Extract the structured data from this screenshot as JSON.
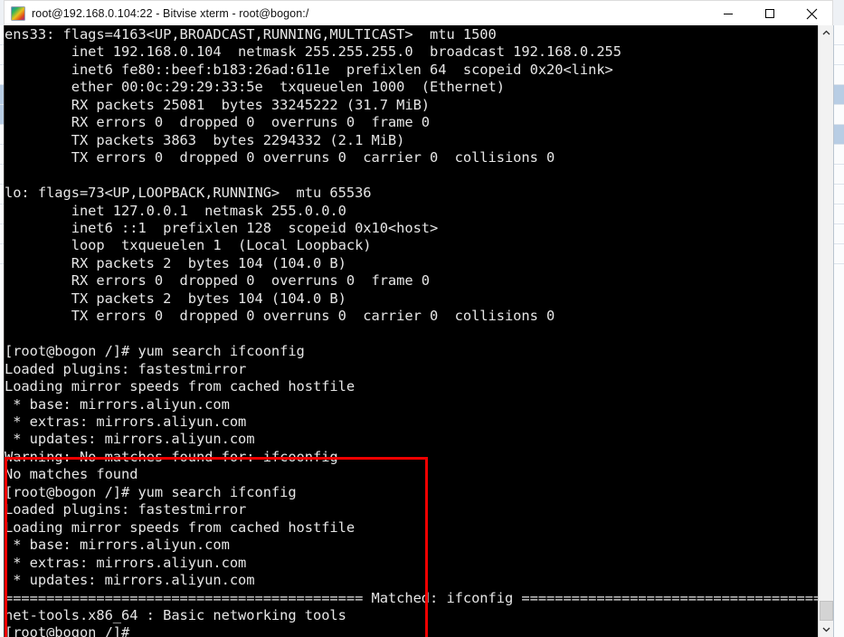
{
  "window": {
    "title": "root@192.168.0.104:22 - Bitvise xterm - root@bogon:/",
    "icon": "bitvise-logo-icon",
    "controls": {
      "minimize": "minimize-icon",
      "maximize": "maximize-icon",
      "close": "close-icon"
    }
  },
  "terminal": {
    "prompt": "[root@bogon /]#",
    "lines": [
      "ens33: flags=4163<UP,BROADCAST,RUNNING,MULTICAST>  mtu 1500",
      "        inet 192.168.0.104  netmask 255.255.255.0  broadcast 192.168.0.255",
      "        inet6 fe80::beef:b183:26ad:611e  prefixlen 64  scopeid 0x20<link>",
      "        ether 00:0c:29:29:33:5e  txqueuelen 1000  (Ethernet)",
      "        RX packets 25081  bytes 33245222 (31.7 MiB)",
      "        RX errors 0  dropped 0  overruns 0  frame 0",
      "        TX packets 3863  bytes 2294332 (2.1 MiB)",
      "        TX errors 0  dropped 0 overruns 0  carrier 0  collisions 0",
      "",
      "lo: flags=73<UP,LOOPBACK,RUNNING>  mtu 65536",
      "        inet 127.0.0.1  netmask 255.0.0.0",
      "        inet6 ::1  prefixlen 128  scopeid 0x10<host>",
      "        loop  txqueuelen 1  (Local Loopback)",
      "        RX packets 2  bytes 104 (104.0 B)",
      "        RX errors 0  dropped 0  overruns 0  frame 0",
      "        TX packets 2  bytes 104 (104.0 B)",
      "        TX errors 0  dropped 0 overruns 0  carrier 0  collisions 0",
      "",
      "[root@bogon /]# yum search ifcoonfig",
      "Loaded plugins: fastestmirror",
      "Loading mirror speeds from cached hostfile",
      " * base: mirrors.aliyun.com",
      " * extras: mirrors.aliyun.com",
      " * updates: mirrors.aliyun.com",
      "Warning: No matches found for: ifcoonfig",
      "No matches found",
      "[root@bogon /]# yum search ifconfig",
      "Loaded plugins: fastestmirror",
      "Loading mirror speeds from cached hostfile",
      " * base: mirrors.aliyun.com",
      " * extras: mirrors.aliyun.com",
      " * updates: mirrors.aliyun.com",
      "=========================================== Matched: ifconfig ===========================================",
      "net-tools.x86_64 : Basic networking tools",
      "[root@bogon /]#"
    ],
    "colors": {
      "background": "#000000",
      "foreground": "#e6e6e6"
    }
  },
  "scrollbar": {
    "up_arrow": "chevron-up-icon",
    "down_arrow": "chevron-down-icon",
    "thumb": "scrollbar-thumb"
  },
  "annotation": {
    "type": "red-rectangle-highlight",
    "color": "#ee0000"
  }
}
